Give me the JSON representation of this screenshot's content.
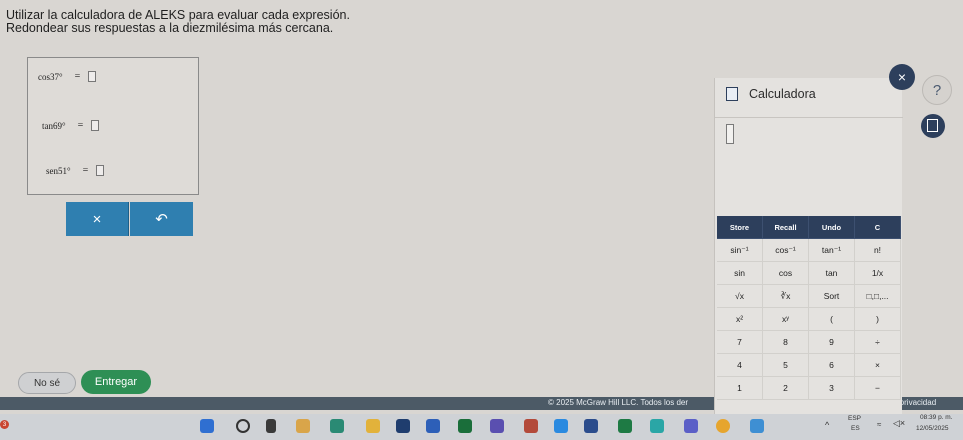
{
  "instructions": {
    "line1": "Utilizar la calculadora de ALEKS para evaluar cada expresión.",
    "line2": "Redondear sus respuestas a la diezmilésima más cercana."
  },
  "problems": [
    {
      "expr": "cos37°",
      "eq": "="
    },
    {
      "expr": "tan69°",
      "eq": "="
    },
    {
      "expr": "sen51°",
      "eq": "="
    }
  ],
  "actions": {
    "clear": "×",
    "undo": "↶"
  },
  "buttons": {
    "no_se": "No sé",
    "entregar": "Entregar"
  },
  "footer": {
    "copyright": "© 2025 McGraw Hill LLC. Todos los der",
    "privacy": "e privacidad"
  },
  "calculator": {
    "title": "Calculadora",
    "close": "×",
    "help": "?",
    "keys": [
      [
        "Store",
        "Recall",
        "Undo",
        "C"
      ],
      [
        "sin⁻¹",
        "cos⁻¹",
        "tan⁻¹",
        "n!"
      ],
      [
        "sin",
        "cos",
        "tan",
        "1/x"
      ],
      [
        "√x",
        "∛x",
        "Sort",
        "□,□,..."
      ],
      [
        "x²",
        "xʸ",
        "(",
        ")"
      ],
      [
        "7",
        "8",
        "9",
        "÷"
      ],
      [
        "4",
        "5",
        "6",
        "×"
      ],
      [
        "1",
        "2",
        "3",
        "−"
      ]
    ]
  },
  "taskbar": {
    "lang1": "ESP",
    "lang2": "ES",
    "time": "08:39 p. m.",
    "date": "12/05/2025",
    "badge": "3"
  },
  "colors": {
    "accent": "#2f7fb0",
    "calc_header": "#2d3f5c",
    "submit": "#2e8f55"
  }
}
